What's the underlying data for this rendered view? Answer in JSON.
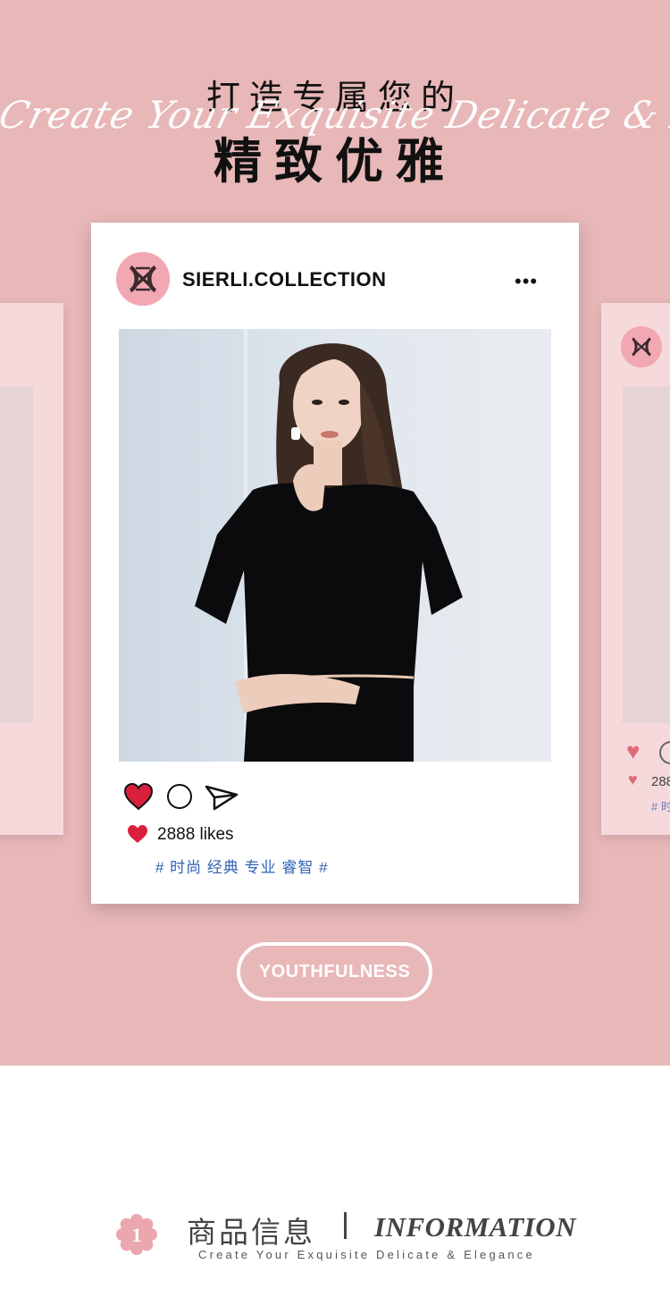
{
  "hero": {
    "headline_line1": "打造专属您的",
    "headline_line2": "精致优雅",
    "script_overlay": "Create Your Exquisite Delicate & Elegance",
    "background_color": "#e8b7b8"
  },
  "post": {
    "account_name": "SIERLI.COLLECTION",
    "more_icon": "•••",
    "likes": "2888 likes",
    "tags": "# 时尚 经典 专业 睿智 #",
    "heart_color": "#d8203c",
    "tag_color": "#2f63b5"
  },
  "side_card": {
    "likes": "288",
    "tag": "# 时"
  },
  "button": {
    "label": "YOUTHFULNESS"
  },
  "section": {
    "badge_number": "1",
    "title_cn": "商品信息",
    "title_en": "INFORMATION",
    "subtitle": "Create Your Exquisite Delicate & Elegance"
  }
}
